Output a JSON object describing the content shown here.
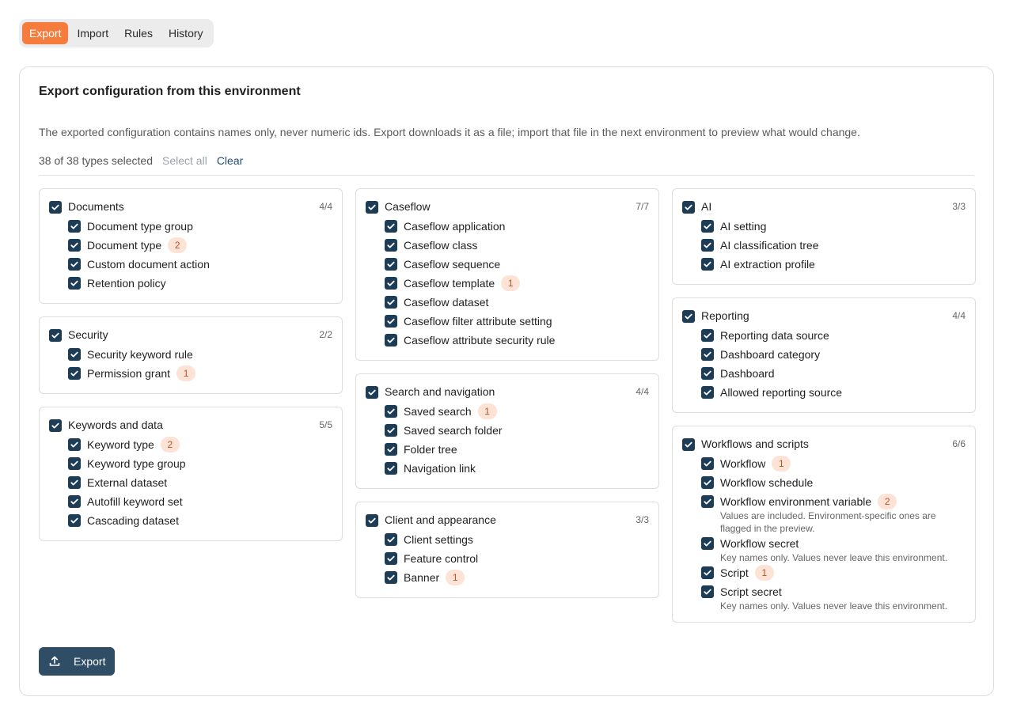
{
  "tabs": [
    {
      "label": "Export",
      "active": true
    },
    {
      "label": "Import",
      "active": false
    },
    {
      "label": "Rules",
      "active": false
    },
    {
      "label": "History",
      "active": false
    }
  ],
  "card": {
    "title": "Export configuration from this environment",
    "description": "The exported configuration contains names only, never numeric ids. Export downloads it as a file; import that file in the next environment to preview what would change.",
    "selection_count": "38 of 38 types selected",
    "select_all_label": "Select all",
    "clear_label": "Clear",
    "export_label": "Export"
  },
  "colors": {
    "accent": "#f57c3d",
    "checkbox": "#1d3d56",
    "badge_bg": "#fde3d6",
    "badge_text": "#b4532a",
    "export_button": "#2f4e66"
  },
  "columns": [
    [
      {
        "name": "Documents",
        "count": "4/4",
        "items": [
          {
            "name": "Document type group"
          },
          {
            "name": "Document type",
            "badge": "2"
          },
          {
            "name": "Custom document action"
          },
          {
            "name": "Retention policy"
          }
        ]
      },
      {
        "name": "Security",
        "count": "2/2",
        "items": [
          {
            "name": "Security keyword rule"
          },
          {
            "name": "Permission grant",
            "badge": "1"
          }
        ]
      },
      {
        "name": "Keywords and data",
        "count": "5/5",
        "items": [
          {
            "name": "Keyword type",
            "badge": "2"
          },
          {
            "name": "Keyword type group"
          },
          {
            "name": "External dataset"
          },
          {
            "name": "Autofill keyword set"
          },
          {
            "name": "Cascading dataset"
          }
        ]
      }
    ],
    [
      {
        "name": "Caseflow",
        "count": "7/7",
        "items": [
          {
            "name": "Caseflow application"
          },
          {
            "name": "Caseflow class"
          },
          {
            "name": "Caseflow sequence"
          },
          {
            "name": "Caseflow template",
            "badge": "1"
          },
          {
            "name": "Caseflow dataset"
          },
          {
            "name": "Caseflow filter attribute setting"
          },
          {
            "name": "Caseflow attribute security rule"
          }
        ]
      },
      {
        "name": "Search and navigation",
        "count": "4/4",
        "items": [
          {
            "name": "Saved search",
            "badge": "1"
          },
          {
            "name": "Saved search folder"
          },
          {
            "name": "Folder tree"
          },
          {
            "name": "Navigation link"
          }
        ]
      },
      {
        "name": "Client and appearance",
        "count": "3/3",
        "items": [
          {
            "name": "Client settings"
          },
          {
            "name": "Feature control"
          },
          {
            "name": "Banner",
            "badge": "1"
          }
        ]
      }
    ],
    [
      {
        "name": "AI",
        "count": "3/3",
        "items": [
          {
            "name": "AI setting"
          },
          {
            "name": "AI classification tree"
          },
          {
            "name": "AI extraction profile"
          }
        ]
      },
      {
        "name": "Reporting",
        "count": "4/4",
        "items": [
          {
            "name": "Reporting data source"
          },
          {
            "name": "Dashboard category"
          },
          {
            "name": "Dashboard"
          },
          {
            "name": "Allowed reporting source"
          }
        ]
      },
      {
        "name": "Workflows and scripts",
        "count": "6/6",
        "items": [
          {
            "name": "Workflow",
            "badge": "1"
          },
          {
            "name": "Workflow schedule"
          },
          {
            "name": "Workflow environment variable",
            "badge": "2",
            "note": "Values are included. Environment-specific ones are flagged in the preview."
          },
          {
            "name": "Workflow secret",
            "note": "Key names only. Values never leave this environment."
          },
          {
            "name": "Script",
            "badge": "1"
          },
          {
            "name": "Script secret",
            "note": "Key names only. Values never leave this environment."
          }
        ]
      }
    ]
  ]
}
